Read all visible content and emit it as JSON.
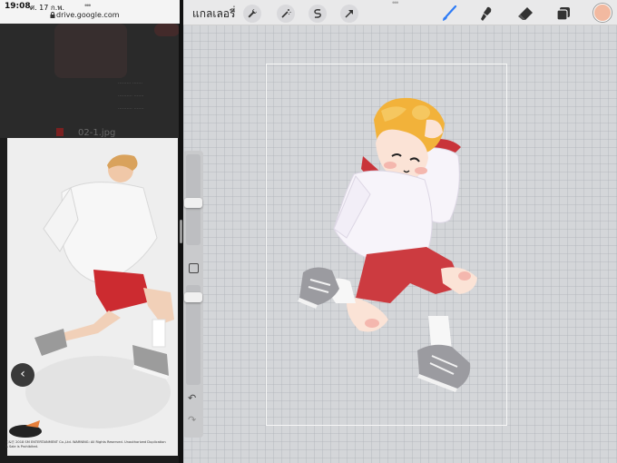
{
  "left_pane": {
    "status_time": "19:08",
    "status_date": "ศ. 17 ก.พ.",
    "url": "drive.google.com",
    "file_name": "02-1.jpg",
    "back_icon": "chevron-left-icon",
    "copyright": "ⓒ&ⓟ 2018 SM ENTERTAINMENT Co.,Ltd. WARNING: All Rights Reserved. Unauthorized Duplication & Sale is Prohibited."
  },
  "toolbar": {
    "gallery_label": "แกลเลอรี่",
    "left_tools": [
      "wrench-icon",
      "magic-wand-icon",
      "selection-icon",
      "transform-arrow-icon"
    ],
    "right_tools": [
      "brush-icon",
      "smudge-icon",
      "eraser-icon",
      "layers-icon"
    ],
    "current_color": "#f2b9a0",
    "accent_color": "#2f7cf6"
  },
  "sidebar": {
    "modify_icon": "square-modify-icon",
    "undo_icon": "undo-icon",
    "redo_icon": "redo-icon",
    "brush_size": 0.35,
    "opacity": 0.05
  }
}
